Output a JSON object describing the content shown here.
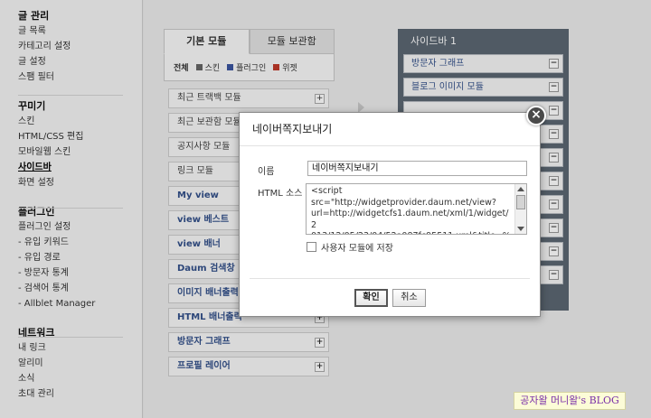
{
  "menu": {
    "groups": [
      {
        "title": "글 관리",
        "items": [
          "글 목록",
          "카테고리 설정",
          "글 설정",
          "스팸 필터"
        ]
      },
      {
        "title": "꾸미기",
        "items": [
          "스킨",
          "HTML/CSS 편집",
          "모바일웹 스킨",
          "사이드바",
          "화면 설정"
        ],
        "active_index": 3
      },
      {
        "title": "플러그인",
        "items": [
          "플러그인 설정",
          "- 유입 키워드",
          "- 유입 경로",
          "- 방문자 통계",
          "- 검색어 통계",
          "- Allblet Manager"
        ]
      },
      {
        "title": "네트워크",
        "items": [
          "내 링크",
          "알리미",
          "소식",
          "초대 관리"
        ]
      }
    ]
  },
  "module_panel": {
    "tabs": [
      "기본 모듈",
      "모듈 보관함"
    ],
    "filters": [
      {
        "label": "전체",
        "color": ""
      },
      {
        "label": "스킨",
        "color": "#666666"
      },
      {
        "label": "플러그인",
        "color": "#3b55a0"
      },
      {
        "label": "위젯",
        "color": "#c0392b"
      }
    ],
    "modules": [
      "최근 트랙백 모듈",
      "최근 보관함 모듈",
      "공지사항 모듈",
      "링크 모듈",
      "My view",
      "view 베스트",
      "view 배너",
      "Daum 검색창",
      "이미지 배너출력",
      "HTML 배너출력",
      "방문자 그래프",
      "프로필 레이어"
    ]
  },
  "sidebar1": {
    "title": "사이드바 1",
    "modules": [
      "방문자 그래프",
      "블로그 이미지 모듈",
      "",
      "",
      "",
      "",
      "",
      "",
      "",
      ""
    ]
  },
  "dialog": {
    "title": "네이버쪽지보내기",
    "name_label": "이름",
    "name_value": "네이버쪽지보내기",
    "html_label": "HTML 소스",
    "html_value": "<script\nsrc=\"http://widgetprovider.daum.net/view?\nurl=http://widgetcfs1.daum.net/xml/1/widget/2\n013/12/05/23/04/52a087fc95511.xml&title=%EC%",
    "save_label": "사용자 모듈에 저장",
    "ok_label": "확인",
    "cancel_label": "취소"
  },
  "watermark": "공자왈 머니왈's BLOG",
  "colors": {
    "sidebar_bg": "#5c6772",
    "module_link": "#33508a",
    "watermark_text": "#7a2fa8"
  }
}
